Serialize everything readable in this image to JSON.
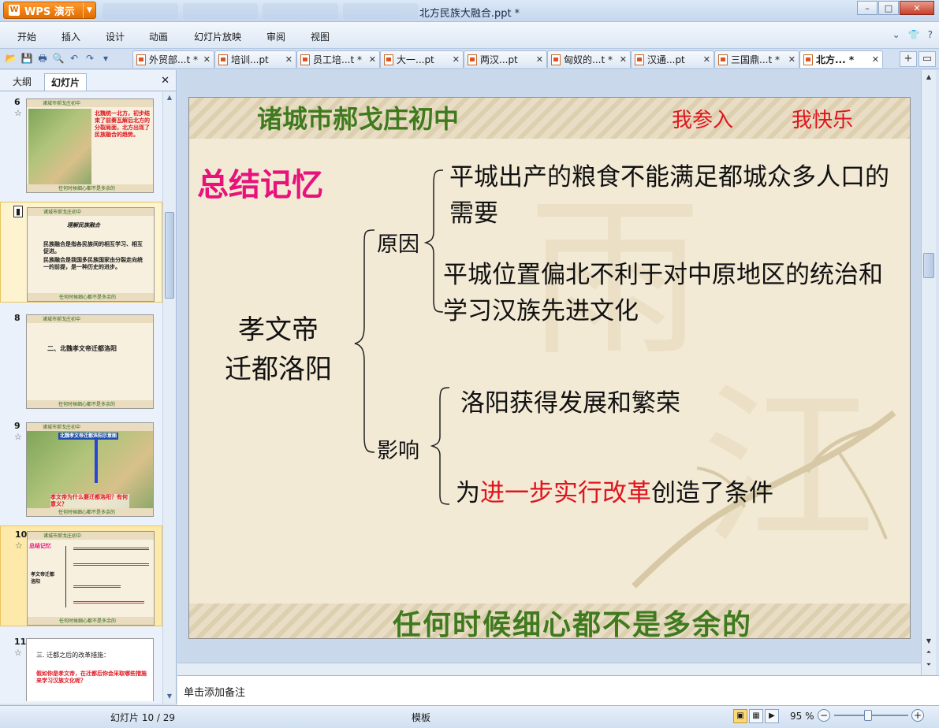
{
  "app": {
    "logo": "WPS 演示",
    "window_title": "北方民族大融合.ppt *",
    "controls": {
      "minimize": "–",
      "maximize": "□",
      "close": "✕"
    }
  },
  "menu": {
    "items": [
      "开始",
      "插入",
      "设计",
      "动画",
      "幻灯片放映",
      "审阅",
      "视图"
    ],
    "right_icons": [
      "chevron-down-icon",
      "shirt-icon",
      "help-icon"
    ]
  },
  "tabs": [
    {
      "label": "外贸部...t *"
    },
    {
      "label": "培训...pt"
    },
    {
      "label": "员工培...t *"
    },
    {
      "label": "大一...pt"
    },
    {
      "label": "两汉...pt"
    },
    {
      "label": "匈奴的...t *"
    },
    {
      "label": "汉通...pt"
    },
    {
      "label": "三国鼎...t *"
    },
    {
      "label": "北方... *"
    }
  ],
  "panel": {
    "tab_outline": "大纲",
    "tab_slides": "幻灯片",
    "thumbnails": [
      {
        "num": "6",
        "header": "诸城市郝戈庄初中",
        "lines": [
          "北魏统一北方，初步结束了前秦瓦解后北方的分裂局面，北方出现了民族融合的趋势。"
        ],
        "footer": "任何时候细心都不是多余的"
      },
      {
        "num": "7",
        "header": "诸城市郝戈庄初中",
        "title": "理解民族融合",
        "lines": [
          "民族融合是指各民族间的相互学习、相互促进。",
          "民族融合是我国多民族国家由分裂走向统一的前提，是一种历史的进步。"
        ],
        "footer": "任何时候细心都不是多余的"
      },
      {
        "num": "8",
        "header": "诸城市郝戈庄初中",
        "title": "二、北魏孝文帝迁都洛阳",
        "footer": "任何时候细心都不是多余的"
      },
      {
        "num": "9",
        "header": "诸城市郝戈庄初中",
        "title": "北魏孝文帝迁都洛阳示意图",
        "question": "孝文帝为什么要迁都洛阳？有何意义？",
        "footer": "任何时候细心都不是多余的"
      },
      {
        "num": "10",
        "header": "诸城市郝戈庄初中",
        "lines": [
          "总结记忆",
          "孝文帝迁都洛阳"
        ],
        "footer": "任何时候细心都不是多余的"
      },
      {
        "num": "11",
        "lines": [
          "三. 迁都之后的改革措施：",
          "假如你是孝文帝，在迁都后你会采取哪些措施来学习汉族文化呢？"
        ]
      }
    ]
  },
  "slide": {
    "school": "诸城市郝戈庄初中",
    "motto1": "我参入",
    "motto2": "我快乐",
    "summary": "总结记忆",
    "emperor_line1": "孝文帝",
    "emperor_line2": "迁都洛阳",
    "cause_label": "原因",
    "effect_label": "影响",
    "cause1": "平城出产的粮食不能满足都城众多人口的需要",
    "cause2": "平城位置偏北不利于对中原地区的统治和学习汉族先进文化",
    "effect1": "洛阳获得发展和繁荣",
    "effect2_pre": "为",
    "effect2_red": "进一步实行改革",
    "effect2_post": "创造了条件",
    "footer": "任何时候细心都不是多余的"
  },
  "notes_placeholder": "单击添加备注",
  "status": {
    "slide_count": "幻灯片 10 / 29",
    "template": "模板",
    "zoom": "95 %",
    "zoom_level_percent": 95
  }
}
